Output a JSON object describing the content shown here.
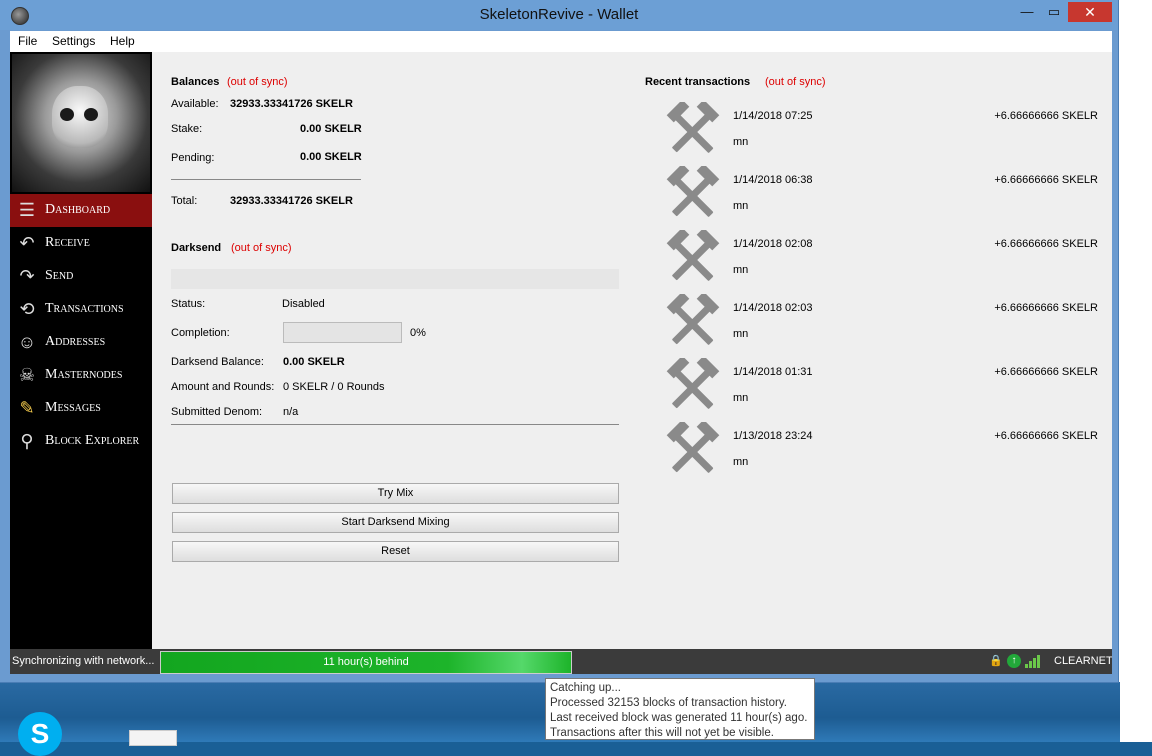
{
  "window": {
    "title": "SkeletonRevive - Wallet",
    "minimize_label": "—",
    "maximize_label": "▭",
    "close_label": "✕"
  },
  "menu": [
    "File",
    "Settings",
    "Help"
  ],
  "sidebar": {
    "items": [
      {
        "label": "Dashboard",
        "icon": "stack-icon",
        "active": true
      },
      {
        "label": "Receive",
        "icon": "arrow-back-icon",
        "active": false
      },
      {
        "label": "Send",
        "icon": "arrow-forward-icon",
        "active": false
      },
      {
        "label": "Transactions",
        "icon": "cycle-icon",
        "active": false
      },
      {
        "label": "Addresses",
        "icon": "contacts-icon",
        "active": false
      },
      {
        "label": "Masternodes",
        "icon": "skull-node-icon",
        "active": false
      },
      {
        "label": "Messages",
        "icon": "notepad-icon",
        "active": false
      },
      {
        "label": "Block Explorer",
        "icon": "magnifier-icon",
        "active": false
      }
    ]
  },
  "balances": {
    "heading": "Balances",
    "sync_note": "(out of sync)",
    "available_label": "Available:",
    "available_value": "32933.33341726 SKELR",
    "stake_label": "Stake:",
    "stake_value": "0.00 SKELR",
    "pending_label": "Pending:",
    "pending_value": "0.00 SKELR",
    "total_label": "Total:",
    "total_value": "32933.33341726 SKELR"
  },
  "darksend": {
    "heading": "Darksend",
    "sync_note": "(out of sync)",
    "status_label": "Status:",
    "status_value": "Disabled",
    "completion_label": "Completion:",
    "completion_value": "0%",
    "completion_fraction": 0,
    "balance_label": "Darksend Balance:",
    "balance_value": "0.00 SKELR",
    "rounds_label": "Amount and Rounds:",
    "rounds_value": "0 SKELR / 0 Rounds",
    "denom_label": "Submitted Denom:",
    "denom_value": "n/a",
    "buttons": {
      "try_mix": "Try Mix",
      "start": "Start Darksend Mixing",
      "reset": "Reset"
    }
  },
  "recent": {
    "heading": "Recent transactions",
    "sync_note": "(out of sync)",
    "transactions": [
      {
        "date": "1/14/2018 07:25",
        "amount": "+6.66666666 SKELR",
        "label": "mn"
      },
      {
        "date": "1/14/2018 06:38",
        "amount": "+6.66666666 SKELR",
        "label": "mn"
      },
      {
        "date": "1/14/2018 02:08",
        "amount": "+6.66666666 SKELR",
        "label": "mn"
      },
      {
        "date": "1/14/2018 02:03",
        "amount": "+6.66666666 SKELR",
        "label": "mn"
      },
      {
        "date": "1/14/2018 01:31",
        "amount": "+6.66666666 SKELR",
        "label": "mn"
      },
      {
        "date": "1/13/2018 23:24",
        "amount": "+6.66666666 SKELR",
        "label": "mn"
      }
    ]
  },
  "statusbar": {
    "sync_text": "Synchronizing with network...",
    "progress_label": "11 hour(s) behind",
    "network": "CLEARNET",
    "lock_icon": "lock-icon",
    "connection_icon": "arrow-up-circle-icon",
    "signal_icon": "signal-bars-icon"
  },
  "tooltip": {
    "lines": [
      "Catching up...",
      "Processed 32153 blocks of transaction history.",
      "Last received block was generated 11 hour(s) ago.",
      "Transactions after this will not yet be visible."
    ]
  },
  "desktop": {
    "skype_letter": "S"
  },
  "colors": {
    "accent_red": "#8a0f0f",
    "sync_note": "#dd0000",
    "progress_green": "#1db42a",
    "titlebar": "#6c9fd5"
  }
}
